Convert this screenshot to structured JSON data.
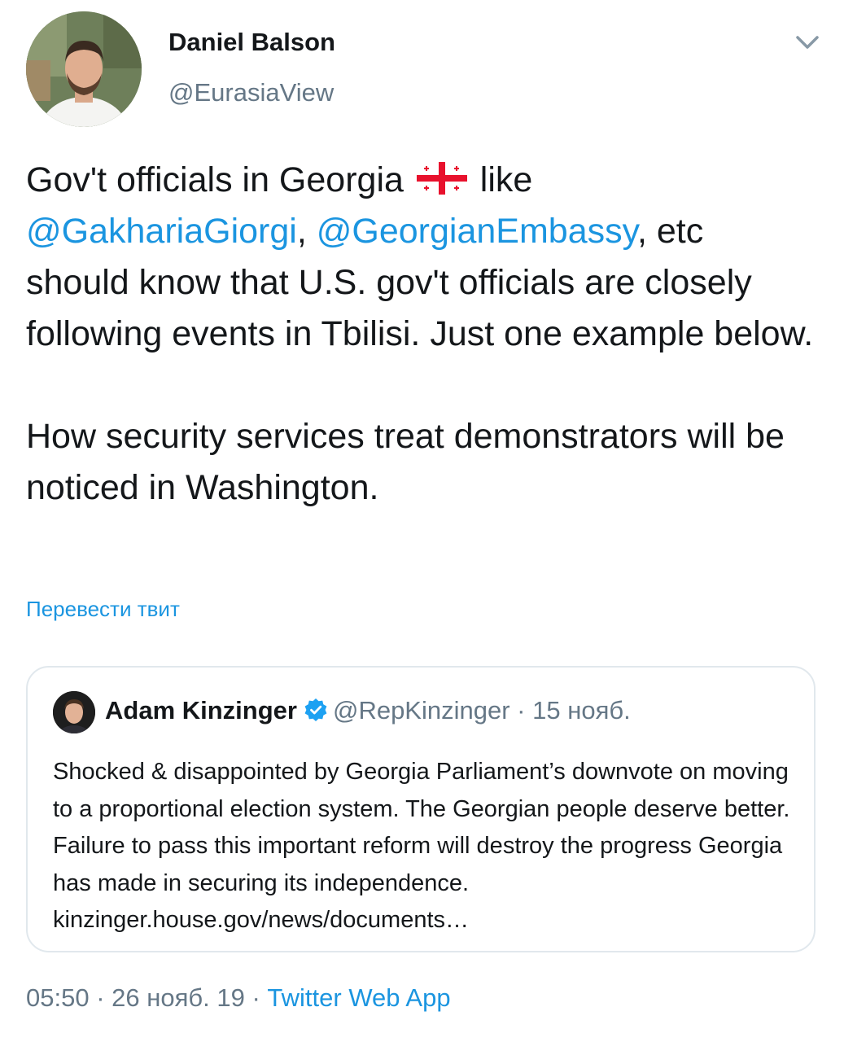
{
  "author": {
    "name": "Daniel Balson",
    "handle": "@EurasiaView"
  },
  "tweet": {
    "line1_a": "Gov't officials in Georgia ",
    "flag_icon": "georgia-flag",
    "line1_b": " like",
    "mention1": "@GakhariaGiorgi",
    "sep": ", ",
    "mention2": "@GeorgianEmbassy",
    "after_mentions": ", etc",
    "para1_rest": "should know that U.S. gov't officials are closely following events in Tbilisi. Just one example below.",
    "para2": "How security services treat demonstrators will be noticed in Washington."
  },
  "translate_label": "Перевести твит",
  "quoted": {
    "name": "Adam Kinzinger",
    "verified_icon": "verified-badge-icon",
    "handle": "@RepKinzinger",
    "dot": " · ",
    "date": "15 нояб.",
    "text": "Shocked & disappointed by Georgia Parliament’s downvote on moving to a proportional election system. The Georgian people deserve better. Failure to pass this important reform will destroy the progress Georgia has made in securing its independence. kinzinger.house.gov/news/documents…"
  },
  "meta": {
    "time": "05:50",
    "dot1": " · ",
    "date": "26 нояб. 19",
    "dot2": " · ",
    "app": "Twitter Web App"
  },
  "colors": {
    "link": "#1b95e0",
    "secondary": "#657786",
    "text": "#14171a",
    "border": "#e1e8ed",
    "verified": "#1da1f2",
    "flag_red": "#e8112d"
  }
}
